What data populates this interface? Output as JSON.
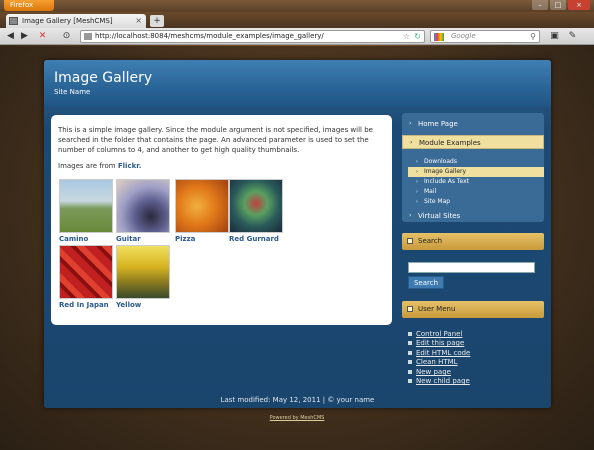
{
  "browser": {
    "app_button": "Firefox",
    "tab_title": "Image Gallery [MeshCMS]",
    "url": "http://localhost:8084/meshcms/module_examples/image_gallery/",
    "search_placeholder": "Google",
    "new_tab": "+",
    "tab_close": "×"
  },
  "header": {
    "title": "Image Gallery",
    "site_name": "Site Name"
  },
  "content": {
    "intro": "This is a simple image gallery. Since the module argument is not specified, images will be searched in the folder that contains the page. An advanced parameter is used to set the number of columns to 4, and another to get high quality thumbnails.",
    "source_prefix": "Images are from ",
    "source_link": "Flickr.",
    "images": [
      {
        "caption": "Camino",
        "color": "#8ea870"
      },
      {
        "caption": "Guitar",
        "color": "#6a6a9a"
      },
      {
        "caption": "Pizza",
        "color": "#e27a1a"
      },
      {
        "caption": "Red Gurnard",
        "color": "#2a5a5a"
      },
      {
        "caption": "Red In Japan",
        "color": "#b62020"
      },
      {
        "caption": "Yellow",
        "color": "#d6b420"
      }
    ]
  },
  "sidebar": {
    "menu": [
      {
        "label": "Home Page",
        "active": false
      },
      {
        "label": "Module Examples",
        "active": true
      }
    ],
    "submenu": [
      {
        "label": "Downloads",
        "active": false
      },
      {
        "label": "Image Gallery",
        "active": true
      },
      {
        "label": "Include As Text",
        "active": false
      },
      {
        "label": "Mail",
        "active": false
      },
      {
        "label": "Site Map",
        "active": false
      }
    ],
    "menu_last": "Virtual Sites",
    "search_title": "Search",
    "search_button": "Search",
    "user_menu_title": "User Menu",
    "user_links": [
      "Control Panel",
      "Edit this page",
      "Edit HTML code",
      "Clean HTML",
      "New page",
      "New child page"
    ]
  },
  "footer": {
    "text": "Last modified: May 12, 2011 | © your name",
    "powered": "Powered by MeshCMS"
  },
  "colors": {
    "page_blue": "#1c4a74",
    "accent_gold": "#e6c168",
    "link_blue": "#2a5a8a"
  }
}
